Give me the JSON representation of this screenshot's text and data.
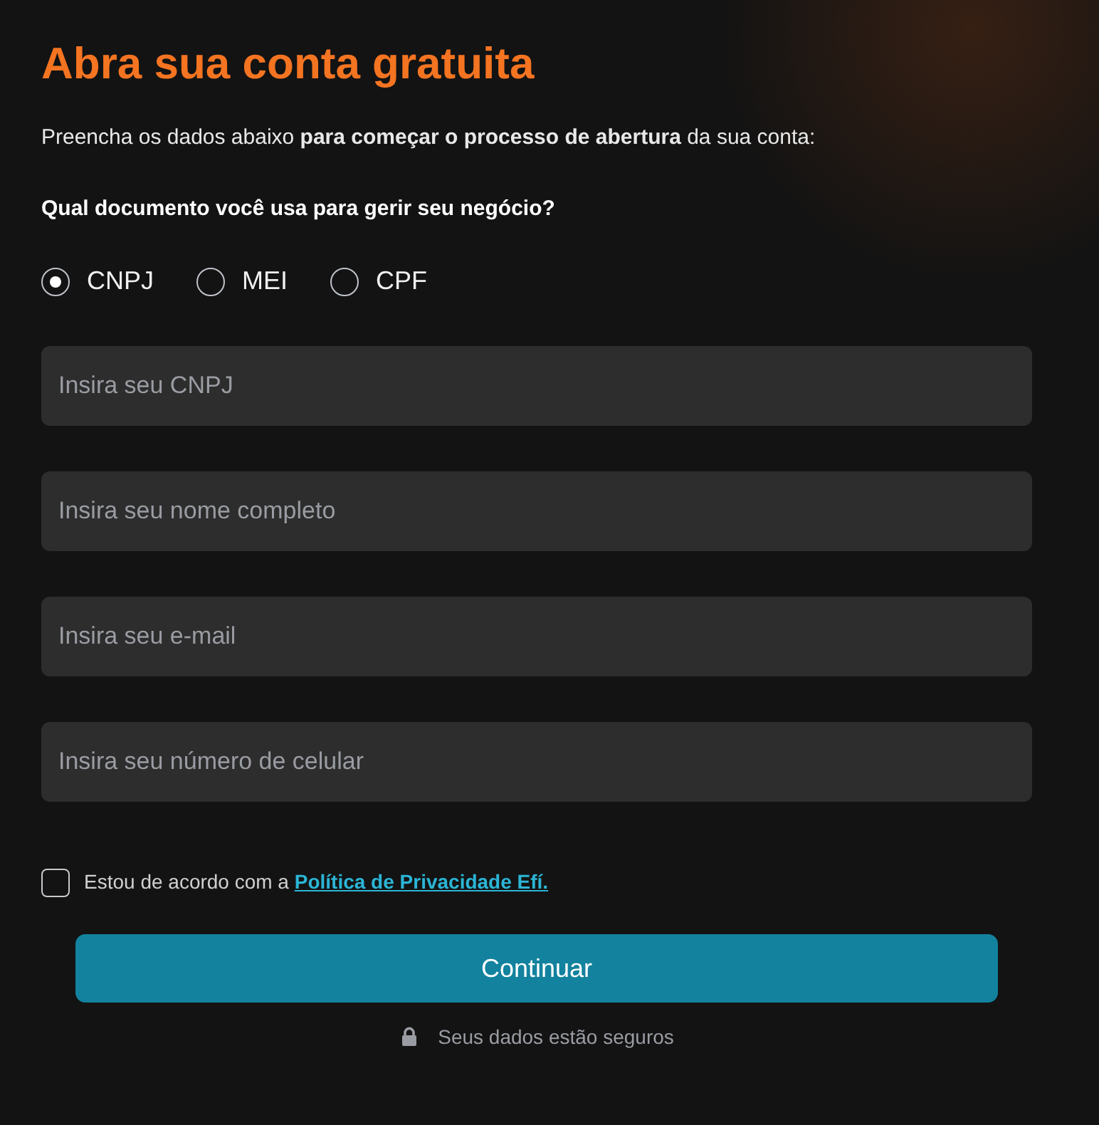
{
  "title": "Abra sua conta gratuita",
  "intro": "Preencha os dados abaixo **para começar o processo de abertura** da sua conta:",
  "question": "Qual documento você usa para gerir seu negócio?",
  "document_types": [
    {
      "label": "CNPJ",
      "selected": true
    },
    {
      "label": "MEI",
      "selected": false
    },
    {
      "label": "CPF",
      "selected": false
    }
  ],
  "fields": [
    {
      "placeholder": "Insira seu CNPJ"
    },
    {
      "placeholder": "Insira seu nome completo"
    },
    {
      "placeholder": "Insira seu e-mail"
    },
    {
      "placeholder": "Insira seu número de celular"
    }
  ],
  "consent": {
    "text": "Estou de acordo com a",
    "link": "Política de Privacidade Efí.",
    "checked": false
  },
  "submit": "Continuar",
  "security_note": "Seus dados estão seguros"
}
